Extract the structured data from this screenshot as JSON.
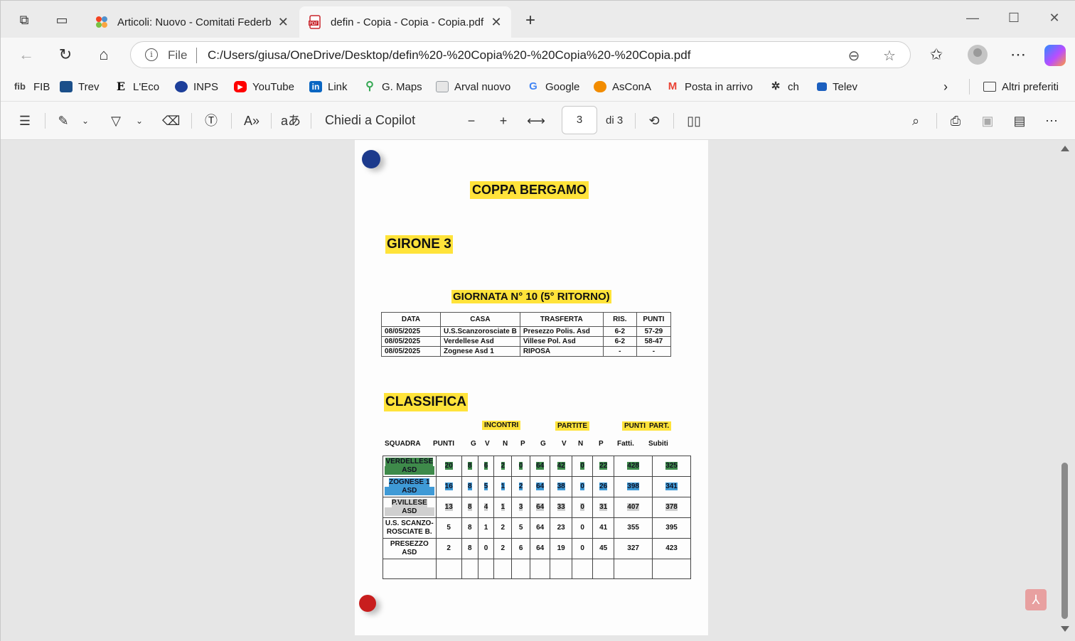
{
  "tabs": [
    {
      "title": "Articoli: Nuovo - Comitati Federbo"
    },
    {
      "title": "defin - Copia - Copia - Copia.pdf"
    }
  ],
  "address": {
    "scheme_label": "File",
    "url": "C:/Users/giusa/OneDrive/Desktop/defin%20-%20Copia%20-%20Copia%20-%20Copia.pdf"
  },
  "bookmarks": [
    {
      "label": "FIB",
      "icon": "fib-logo-icon",
      "color": "#444444"
    },
    {
      "label": "Trev",
      "icon": "trev-logo-icon",
      "color": "#1b4f8a"
    },
    {
      "label": "L'Eco",
      "icon": "eco-logo-icon",
      "color": "#111111"
    },
    {
      "label": "INPS",
      "icon": "inps-logo-icon",
      "color": "#1d3f9a"
    },
    {
      "label": "YouTube",
      "icon": "youtube-icon",
      "color": "#ff0000"
    },
    {
      "label": "Link",
      "icon": "linkedin-icon",
      "color": "#0a66c2"
    },
    {
      "label": "G. Maps",
      "icon": "maps-pin-icon",
      "color": "#34a853"
    },
    {
      "label": "Arval nuovo",
      "icon": "page-icon",
      "color": "#9aa0a6"
    },
    {
      "label": "Google",
      "icon": "google-icon",
      "color": "#4285f4"
    },
    {
      "label": "AsConA",
      "icon": "cloud-icon",
      "color": "#f28c00"
    },
    {
      "label": "Posta in arrivo",
      "icon": "gmail-icon",
      "color": "#ea4335"
    },
    {
      "label": "ch",
      "icon": "chatgpt-icon",
      "color": "#333333"
    },
    {
      "label": "Telev",
      "icon": "rai-icon",
      "color": "#1b5fbf"
    }
  ],
  "other_favorites": "Altri preferiti",
  "pdf_toolbar": {
    "ask_copilot": "Chiedi a Copilot",
    "page_current": "3",
    "page_total": "di 3"
  },
  "document": {
    "title": "COPPA BERGAMO",
    "group": "GIRONE 3",
    "matchday": "GIORNATA N° 10 (5° RITORNO)",
    "results_headers": [
      "DATA",
      "CASA",
      "TRASFERTA",
      "RIS.",
      "PUNTI"
    ],
    "results_rows": [
      [
        "08/05/2025",
        "U.S.Scanzorosciate B",
        "Presezzo Polis. Asd",
        "6-2",
        "57-29"
      ],
      [
        "08/05/2025",
        "Verdellese Asd",
        "Villese Pol. Asd",
        "6-2",
        "58-47"
      ],
      [
        "08/05/2025",
        "Zognese Asd 1",
        "RIPOSA",
        "-",
        "-"
      ]
    ],
    "standings_title": "CLASSIFICA",
    "group_headers": {
      "matches": "INCONTRI",
      "games": "PARTITE",
      "points": "PUNTI",
      "part": "PART."
    },
    "standings_headers": [
      "SQUADRA",
      "PUNTI",
      "G",
      "V",
      "N",
      "P",
      "G",
      "V",
      "N",
      "P",
      "Fatti.",
      "Subiti"
    ],
    "standings_rows": [
      {
        "team_line1": "VERDELLESE",
        "team_line2": "ASD",
        "values": [
          "20",
          "8",
          "6",
          "2",
          "0",
          "64",
          "42",
          "0",
          "22",
          "428",
          "325"
        ],
        "highlight": "green"
      },
      {
        "team_line1": "ZOGNESE 1",
        "team_line2": "ASD",
        "values": [
          "16",
          "8",
          "5",
          "1",
          "2",
          "64",
          "38",
          "0",
          "26",
          "398",
          "341"
        ],
        "highlight": "blue"
      },
      {
        "team_line1": "P.VILLESE",
        "team_line2": "ASD",
        "values": [
          "13",
          "8",
          "4",
          "1",
          "3",
          "64",
          "33",
          "0",
          "31",
          "407",
          "378"
        ],
        "highlight": "gray"
      },
      {
        "team_line1": "U.S. SCANZO-",
        "team_line2": "ROSCIATE B.",
        "values": [
          "5",
          "8",
          "1",
          "2",
          "5",
          "64",
          "23",
          "0",
          "41",
          "355",
          "395"
        ],
        "highlight": "none"
      },
      {
        "team_line1": "PRESEZZO",
        "team_line2": "ASD",
        "values": [
          "2",
          "8",
          "0",
          "2",
          "6",
          "64",
          "19",
          "0",
          "45",
          "327",
          "423"
        ],
        "highlight": "none"
      }
    ]
  }
}
